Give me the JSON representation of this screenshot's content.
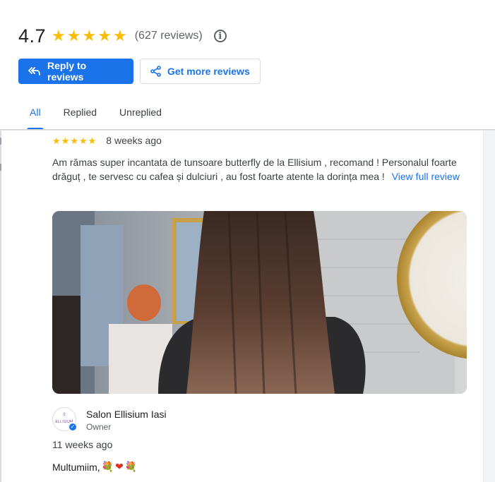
{
  "rating": {
    "value": "4.7",
    "stars": [
      "★",
      "★",
      "★",
      "★",
      "★"
    ],
    "count_text": "(627 reviews)",
    "info_icon_char": "i"
  },
  "actions": {
    "reply_label": "Reply to reviews",
    "more_label": "Get more reviews"
  },
  "tabs": [
    {
      "label": "All",
      "active": true
    },
    {
      "label": "Replied",
      "active": false
    },
    {
      "label": "Unreplied",
      "active": false
    }
  ],
  "review": {
    "stars": [
      "★",
      "★",
      "★",
      "★",
      "★"
    ],
    "time": "8 weeks ago",
    "text": "Am rămas super incantata de tunsoare butterfly de la Ellisium , recomand ! Personalul foarte drăguț , te servesc cu cafea și dulciuri , au fost foarte atente la dorința mea !",
    "view_full": "View full review",
    "photo_icon": "hair-salon-photo"
  },
  "owner_reply": {
    "name": "Salon Ellisium Iasi",
    "role": "Owner",
    "avatar_text": "ELLISIUM",
    "time": "11 weeks ago",
    "text": "Multumiim,",
    "emojis": [
      "💐",
      "❤",
      "💐"
    ]
  },
  "colors": {
    "accent": "#1a73e8",
    "star": "#fbbc04",
    "heart": "#d93025"
  }
}
